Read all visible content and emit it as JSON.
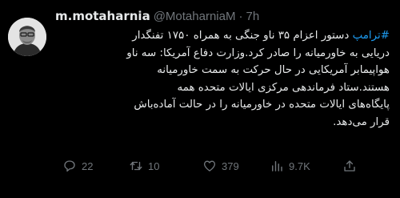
{
  "tweet": {
    "display_name": "m.motaharnia",
    "handle": "@MotaharniaM",
    "separator": "·",
    "time": "7h",
    "hashtag": "#ترامپ",
    "lines": [
      "دستور اعزام ۳۵ ناو جنگی به همراه ۱۷۵۰ تفنگدار",
      "دریایی به خاورمیانه را صادر کرد.وزارت دفاع آمریکا: سه ناو",
      "هواپیمابر آمریکایی در حال حرکت به سمت خاورمیانه",
      "هستند.ستاد فرماندهی مرکزی ایالات متحده همه",
      "پایگاه‌های ایالات متحده در خاورمیانه را در حالت آماده‌باش",
      "قرار می‌دهد."
    ]
  },
  "actions": {
    "replies": "22",
    "retweets": "10",
    "likes": "379",
    "views": "9.7K"
  },
  "icons": {
    "reply": "reply-icon",
    "retweet": "retweet-icon",
    "like": "heart-icon",
    "views": "views-chart-icon",
    "share": "share-icon"
  },
  "colors": {
    "background": "#000000",
    "text": "#e7e9ea",
    "muted": "#71767b",
    "accent": "#1d9bf0"
  }
}
